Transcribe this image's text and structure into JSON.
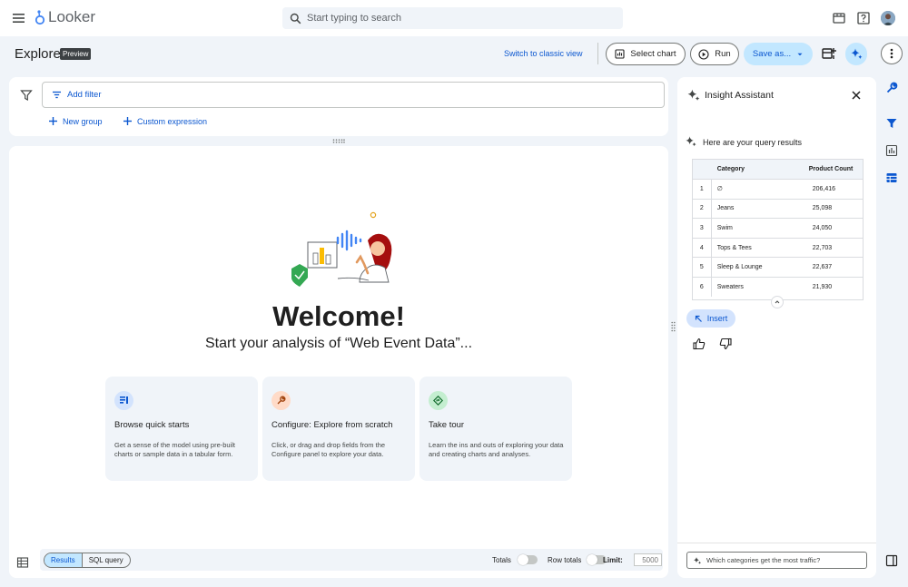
{
  "app": {
    "name": "Looker"
  },
  "search": {
    "placeholder": "Start typing to search"
  },
  "header": {
    "title": "Explore",
    "badge": "Preview",
    "classic_link": "Switch to classic view",
    "select_chart": "Select chart",
    "run": "Run",
    "save_as": "Save as..."
  },
  "filters": {
    "add_filter": "Add filter",
    "new_group": "New group",
    "custom_expression": "Custom expression"
  },
  "welcome": {
    "title": "Welcome!",
    "subtitle": "Start your analysis of “Web Event Data”..."
  },
  "tiles": [
    {
      "title": "Browse quick starts",
      "desc": "Get a sense of the model using pre-built charts or sample data in a tabular form.",
      "icon": "quick-starts-icon",
      "color": "#d3e3fd"
    },
    {
      "title": "Configure: Explore from scratch",
      "desc": "Click, or drag and drop fields from the Configure panel to explore your data.",
      "icon": "wrench-icon",
      "color": "#ffdbc8"
    },
    {
      "title": "Take tour",
      "desc": "Learn the ins and outs of exploring your data and creating charts and analyses.",
      "icon": "directions-icon",
      "color": "#c4eed0"
    }
  ],
  "bottom_bar": {
    "results": "Results",
    "sql_query": "SQL query",
    "totals": "Totals",
    "row_totals": "Row totals",
    "limit_label": "Limit:",
    "limit_value": "5000"
  },
  "assistant": {
    "title": "Insight Assistant",
    "message": "Here are your query results",
    "columns": [
      "Category",
      "Product Count"
    ],
    "rows": [
      {
        "n": "1",
        "category": "∅",
        "count": "206,416"
      },
      {
        "n": "2",
        "category": "Jeans",
        "count": "25,098"
      },
      {
        "n": "3",
        "category": "Swim",
        "count": "24,050"
      },
      {
        "n": "4",
        "category": "Tops & Tees",
        "count": "22,703"
      },
      {
        "n": "5",
        "category": "Sleep & Lounge",
        "count": "22,637"
      },
      {
        "n": "6",
        "category": "Sweaters",
        "count": "21,930"
      }
    ],
    "insert": "Insert",
    "input_placeholder": "Which categories get the most traffic?"
  },
  "colors": {
    "accent": "#0b57d0",
    "accent_light": "#c2e7ff",
    "background": "#f0f4f9"
  }
}
